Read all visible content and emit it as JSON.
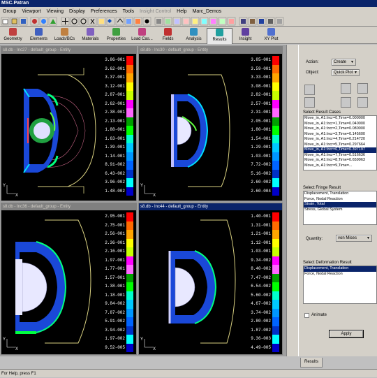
{
  "app": {
    "title": "MSC.Patran"
  },
  "menu": [
    "Group",
    "Viewport",
    "Viewing",
    "Display",
    "Preferences",
    "Tools",
    "Insight Control",
    "Help",
    "Marc_Demos"
  ],
  "tabs": [
    {
      "label": "Geometry"
    },
    {
      "label": "Elements"
    },
    {
      "label": "Loads/BCs"
    },
    {
      "label": "Materials"
    },
    {
      "label": "Properties"
    },
    {
      "label": "Load Cas..."
    },
    {
      "label": "Fields"
    },
    {
      "label": "Analysis"
    },
    {
      "label": "Results"
    },
    {
      "label": "Insight"
    },
    {
      "label": "XY Plot"
    }
  ],
  "viewports": [
    {
      "title": "s8.db - Inc27 - default_group - Entity",
      "values": [
        "3.86-001",
        "3.62-001",
        "3.37-001",
        "3.12-001",
        "2.87-001",
        "2.62-001",
        "2.38-001",
        "2.13-001",
        "1.88-001",
        "1.63-001",
        "1.39-001",
        "1.14-001",
        "8.91-002",
        "6.43-002",
        "3.96-002",
        "1.48-002"
      ]
    },
    {
      "title": "s8.db - Inc30 - default_group - Entity",
      "values": [
        "3.85-001",
        "3.59-001",
        "3.33-001",
        "3.08-001",
        "2.82-001",
        "2.57-001",
        "2.31-001",
        "2.05-001",
        "1.80-001",
        "1.54-001",
        "1.29-001",
        "1.03-001",
        "7.72-002",
        "5.16-002",
        "2.60-002",
        "2.60-004"
      ]
    },
    {
      "title": "s8.db - Inc36 - default_group - Entity",
      "values": [
        "2.95-001",
        "2.75-001",
        "2.56-001",
        "2.36-001",
        "2.16-001",
        "1.97-001",
        "1.77-001",
        "1.57-001",
        "1.38-001",
        "1.18-001",
        "9.84-002",
        "7.87-002",
        "5.91-002",
        "3.94-002",
        "1.97-002",
        "9.52-005"
      ]
    },
    {
      "title": "s8.db - Inc44 - default_group - Entity",
      "values": [
        "1.40-001",
        "1.31-001",
        "1.21-001",
        "1.12-001",
        "1.03-001",
        "9.34-002",
        "8.40-002",
        "7.47-002",
        "6.54-002",
        "5.60-002",
        "4.67-002",
        "3.74-002",
        "2.80-002",
        "1.87-002",
        "9.36-003",
        "4.49-005"
      ]
    }
  ],
  "panel": {
    "action_label": "Action:",
    "action_value": "Create",
    "object_label": "Object:",
    "object_value": "Quick Plot",
    "select_cases_label": "Select Result Cases",
    "cases": [
      "Move_in, A1:Incr=0,Time=0.000000",
      "Move_in, A1:Incr=1,Time=0.040000",
      "Move_in, A1:Incr=2,Time=0.080000",
      "Move_in, A1:Incr=3,Time=0.145600",
      "Move_in, A1:Incr=4,Time=0.214720",
      "Move_in, A1:Incr=5,Time=0.297664",
      "Move_in, A1:Incr=6,Time=0.397197",
      "Move_in, A1:Incr=7,Time=0.516636",
      "Move_in, A1:Incr=8,Time=0.659963",
      "Move_in, A1:Incr=9,Time=..."
    ],
    "selected_case": 6,
    "fringe_label": "Select Fringe Result",
    "fringe": [
      "Displacement, Translation",
      "Force, Nodal Reaction",
      "Strain, Total",
      "Stress, Global System"
    ],
    "selected_fringe": 2,
    "quantity_label": "Quantity:",
    "quantity_value": "von Mises",
    "deform_label": "Select Deformation Result",
    "deform": [
      "Displacement, Translation",
      "Force, Nodal Reaction"
    ],
    "selected_deform": 0,
    "animate_label": "Animate",
    "apply_label": "Apply",
    "results_tab": "Results"
  },
  "status": {
    "text": "For Help, press F1"
  },
  "colors": {
    "scale": [
      "#ff0000",
      "#ff6a00",
      "#ffa500",
      "#ffff00",
      "#c8ff00",
      "#ff00ff",
      "#ff66ff",
      "#00a000",
      "#00ff00",
      "#00ffcc",
      "#00c8ff",
      "#0096ff",
      "#0064ff",
      "#0032c8",
      "#00ffff",
      "#0000c8"
    ]
  }
}
